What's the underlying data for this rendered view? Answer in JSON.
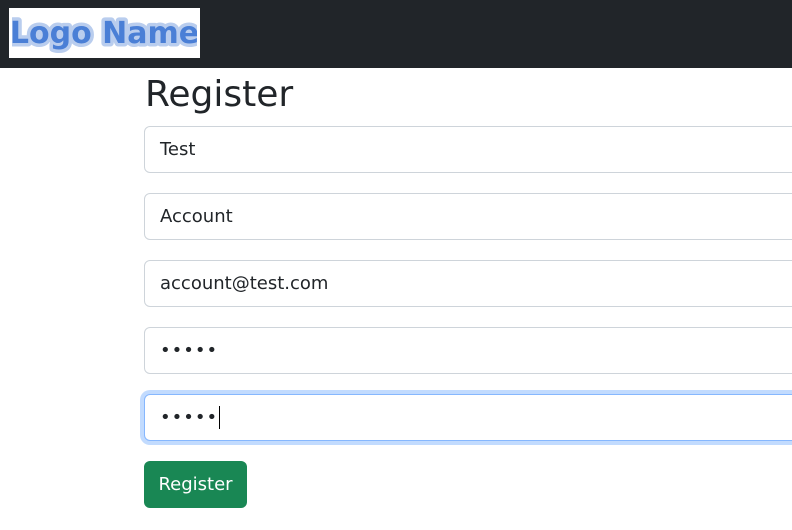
{
  "navbar": {
    "logo_text": "Logo Name"
  },
  "page": {
    "title": "Register"
  },
  "form": {
    "first_name_value": "Test",
    "last_name_value": "Account",
    "email_value": "account@test.com",
    "password_value": "•••••",
    "confirm_password_value": "•••••",
    "submit_label": "Register"
  },
  "colors": {
    "navbar_bg": "#212529",
    "logo_fill": "#4a7fd6",
    "button_bg": "#198754",
    "focus_border": "#86b7fe"
  }
}
